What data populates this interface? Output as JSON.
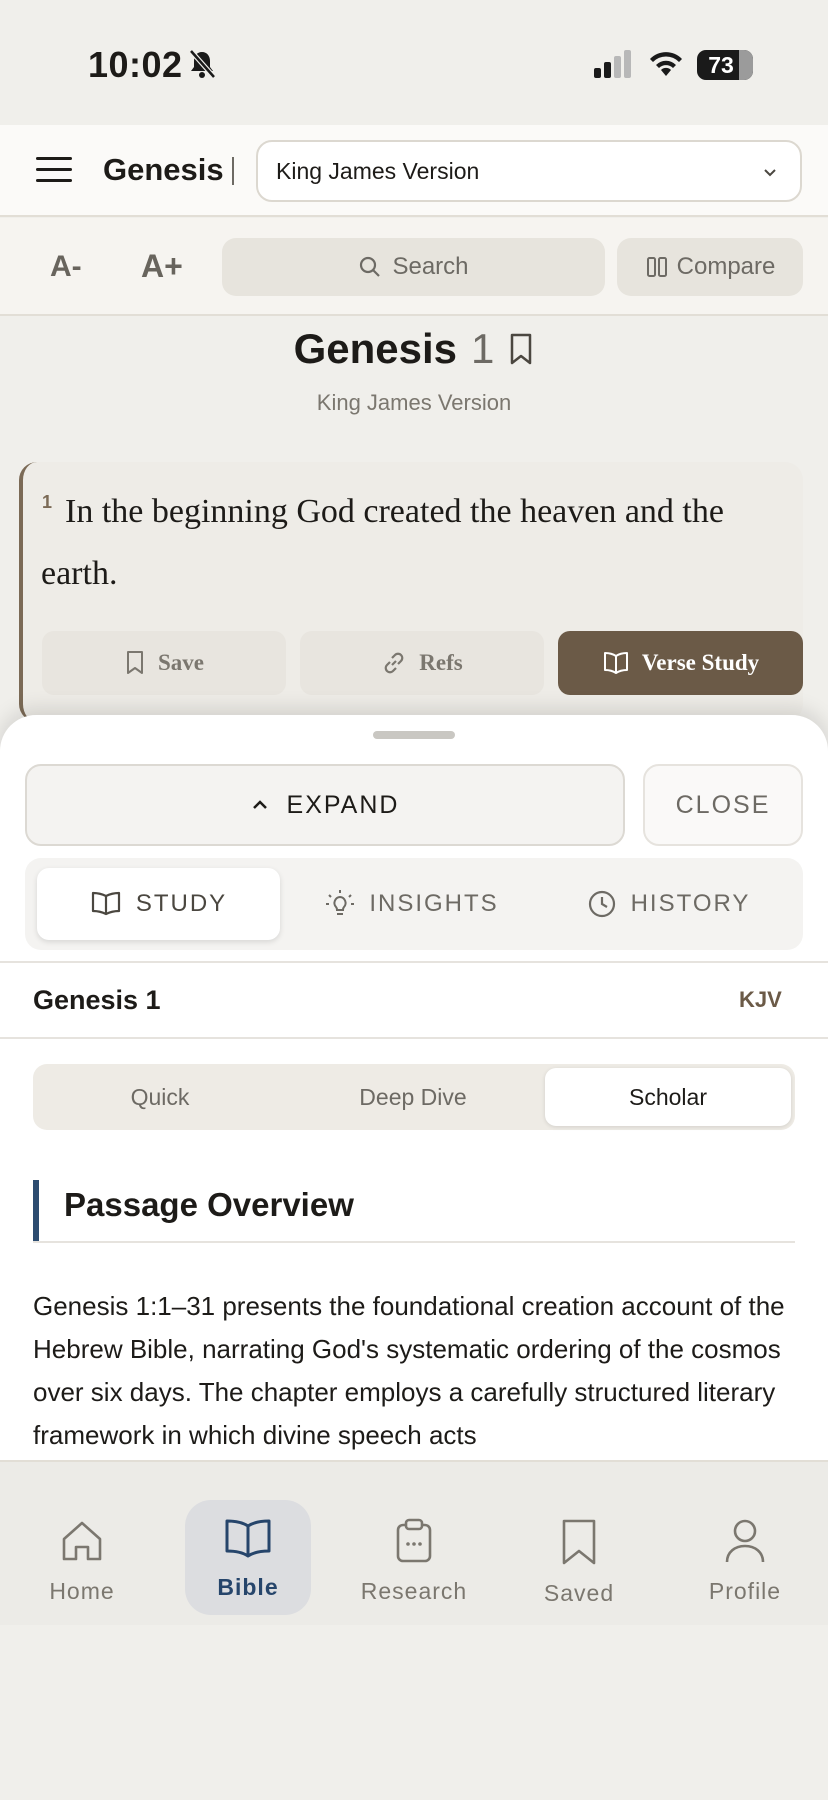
{
  "status_bar": {
    "time": "10:02",
    "battery": "73"
  },
  "header": {
    "book": "Genesis",
    "version_select": "King James Version"
  },
  "toolbar": {
    "font_smaller": "A-",
    "font_larger": "A+",
    "search_label": "Search",
    "compare_label": "Compare"
  },
  "chapter": {
    "book": "Genesis",
    "number": "1",
    "version": "King James Version"
  },
  "verse": {
    "number": "1",
    "text": "In the beginning God created the heaven and the earth.",
    "actions": {
      "save": "Save",
      "refs": "Refs",
      "study": "Verse Study"
    }
  },
  "sheet": {
    "expand_label": "EXPAND",
    "close_label": "CLOSE",
    "tabs": [
      "STUDY",
      "INSIGHTS",
      "HISTORY"
    ],
    "active_tab": "STUDY",
    "section_title": "Genesis 1",
    "section_version": "KJV",
    "modes": [
      "Quick",
      "Deep Dive",
      "Scholar"
    ],
    "active_mode": "Scholar",
    "overview_title": "Passage Overview",
    "overview_text": "Genesis 1:1–31 presents the foundational creation account of the Hebrew Bible, narrating God's systematic ordering of the cosmos over six days. The chapter employs a carefully structured literary framework in which divine speech acts"
  },
  "nav": {
    "items": [
      "Home",
      "Bible",
      "Research",
      "Saved",
      "Profile"
    ],
    "active": "Bible"
  },
  "colors": {
    "accent_brown": "#6b5a47",
    "nav_active": "#26456b",
    "overview_bar": "#2c4c70"
  }
}
